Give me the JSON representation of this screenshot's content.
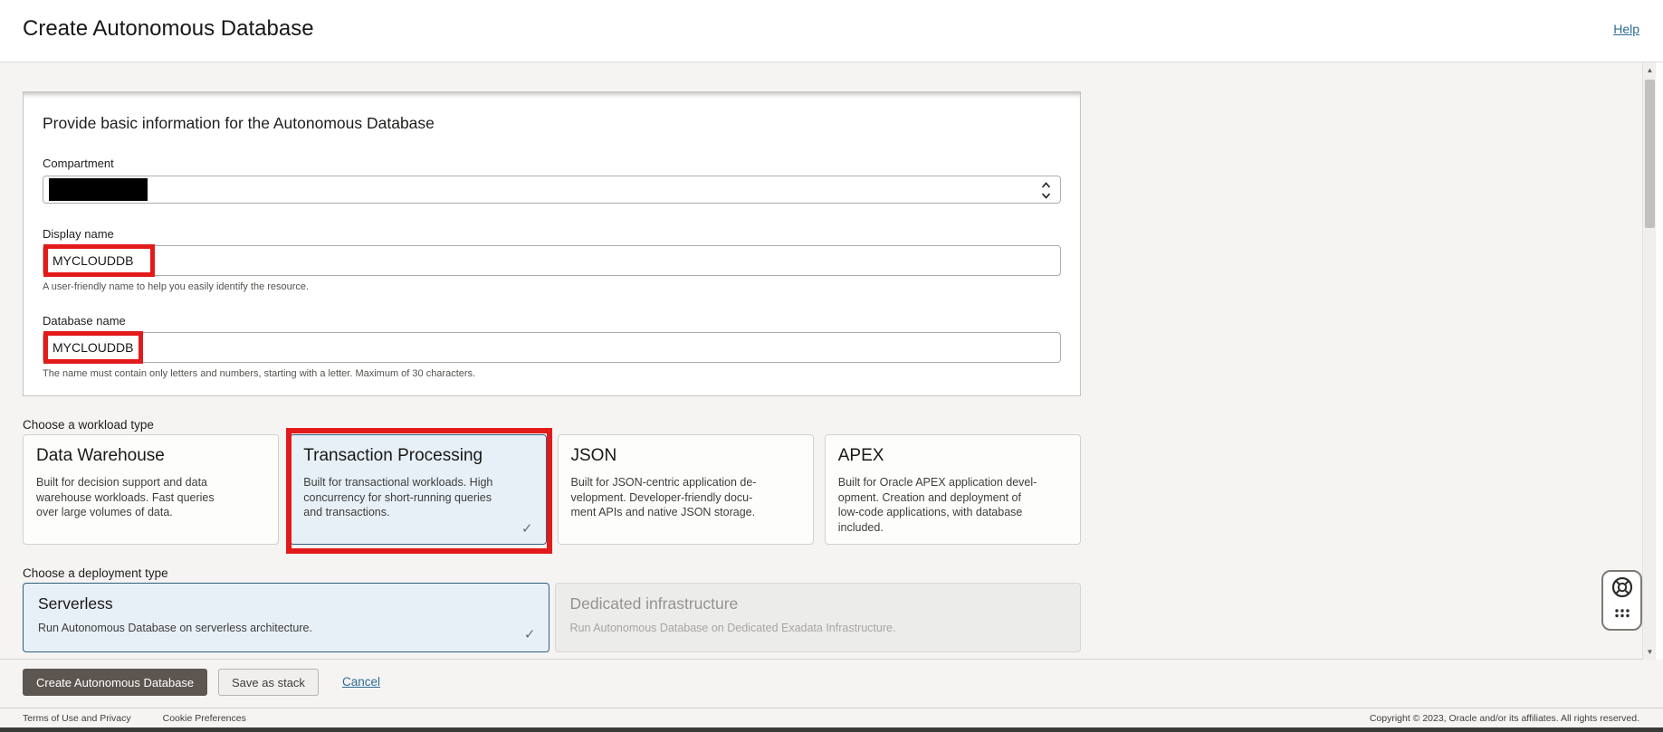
{
  "header": {
    "title": "Create Autonomous Database",
    "help_label": "Help"
  },
  "basic_info": {
    "heading": "Provide basic information for the Autonomous Database",
    "compartment": {
      "label": "Compartment",
      "value_redacted": true
    },
    "display_name": {
      "label": "Display name",
      "value": "MYCLOUDDB",
      "helper": "A user-friendly name to help you easily identify the resource."
    },
    "database_name": {
      "label": "Database name",
      "value": "MYCLOUDDB",
      "helper": "The name must contain only letters and numbers, starting with a letter. Maximum of 30 characters."
    }
  },
  "workload": {
    "label": "Choose a workload type",
    "cards": [
      {
        "title": "Data Warehouse",
        "description": "Built for decision support and data\nwarehouse workloads. Fast queries\nover large volumes of data.",
        "selected": false
      },
      {
        "title": "Transaction Processing",
        "description": "Built for transactional workloads. High\nconcurrency for short-running queries\nand transactions.",
        "selected": true,
        "checkmark": "✓"
      },
      {
        "title": "JSON",
        "description": "Built for JSON-centric application de-\nvelopment. Developer-friendly docu-\nment APIs and native JSON storage.",
        "selected": false
      },
      {
        "title": "APEX",
        "description": "Built for Oracle APEX application devel-\nopment. Creation and deployment of\nlow-code applications, with database\nincluded.",
        "selected": false
      }
    ]
  },
  "deployment": {
    "label": "Choose a deployment type",
    "cards": [
      {
        "title": "Serverless",
        "description": "Run Autonomous Database on serverless architecture.",
        "selected": true,
        "checkmark": "✓"
      },
      {
        "title": "Dedicated infrastructure",
        "description": "Run Autonomous Database on Dedicated Exadata Infrastructure.",
        "disabled": true
      }
    ]
  },
  "actions": {
    "create_label": "Create Autonomous Database",
    "save_stack_label": "Save as stack",
    "cancel_label": "Cancel"
  },
  "footer": {
    "terms_label": "Terms of Use and Privacy",
    "cookies_label": "Cookie Preferences",
    "copyright": "Copyright © 2023, Oracle and/or its affiliates. All rights reserved."
  },
  "scrollbar": {
    "up_glyph": "▲",
    "down_glyph": "▼"
  },
  "colors": {
    "annotation_red": "#e31a1a",
    "selected_card_bg": "#e7f0f7",
    "selected_card_border": "#2f607f",
    "primary_button_bg": "#5d5650",
    "link_blue": "#2e6c97",
    "content_bg": "#f5f4f2"
  }
}
